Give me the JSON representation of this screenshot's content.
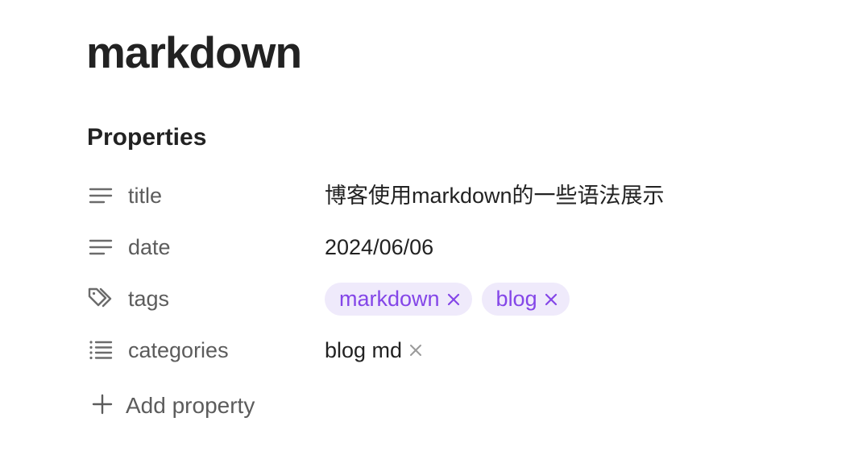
{
  "page": {
    "title": "markdown"
  },
  "properties": {
    "heading": "Properties",
    "rows": [
      {
        "key": "title",
        "icon": "text-lines-icon",
        "value": "博客使用markdown的一些语法展示"
      },
      {
        "key": "date",
        "icon": "text-lines-icon",
        "value": "2024/06/06"
      },
      {
        "key": "tags",
        "icon": "tags-icon",
        "tags": [
          "markdown",
          "blog"
        ]
      },
      {
        "key": "categories",
        "icon": "list-icon",
        "items": [
          "blog md"
        ]
      }
    ],
    "add_label": "Add property"
  },
  "colors": {
    "tag_bg": "#efeafb",
    "tag_text": "#8446e8",
    "muted_text": "#5c5c5c",
    "icon_gray": "#6b6b6b"
  }
}
